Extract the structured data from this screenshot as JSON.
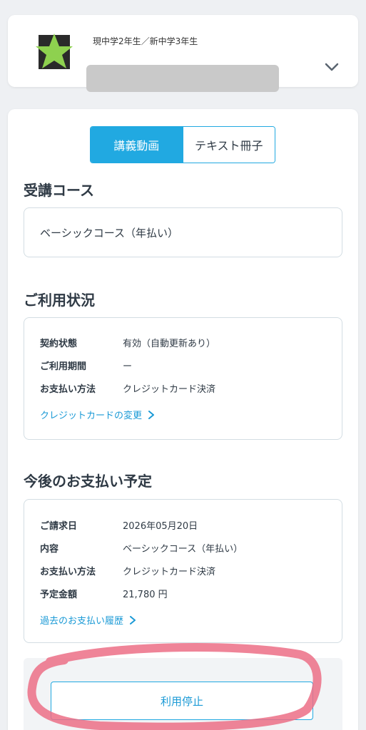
{
  "student": {
    "grade_label": "現中学2年生／新中学3年生"
  },
  "tabs": [
    {
      "label": "講義動画",
      "active": true
    },
    {
      "label": "テキスト冊子",
      "active": false
    }
  ],
  "course": {
    "title": "受講コース",
    "name": "ベーシックコース（年払い）"
  },
  "usage": {
    "title": "ご利用状況",
    "rows": [
      {
        "key": "契約状態",
        "value": "有効（自動更新あり）"
      },
      {
        "key": "ご利用期間",
        "value": "ー"
      },
      {
        "key": "お支払い方法",
        "value": "クレジットカード決済"
      }
    ],
    "link": "クレジットカードの変更"
  },
  "payment": {
    "title": "今後のお支払い予定",
    "rows": [
      {
        "key": "ご請求日",
        "value": "2026年05月20日"
      },
      {
        "key": "内容",
        "value": "ベーシックコース（年払い）"
      },
      {
        "key": "お支払い方法",
        "value": "クレジットカード決済"
      },
      {
        "key": "予定金額",
        "value": "21,780 円"
      }
    ],
    "link": "過去のお支払い履歴"
  },
  "stop_button": "利用停止",
  "colors": {
    "accent": "#21a9e1",
    "link": "#1b9ad6",
    "annotation": "#ec6f86",
    "avatar_star": "#8ed14f"
  }
}
